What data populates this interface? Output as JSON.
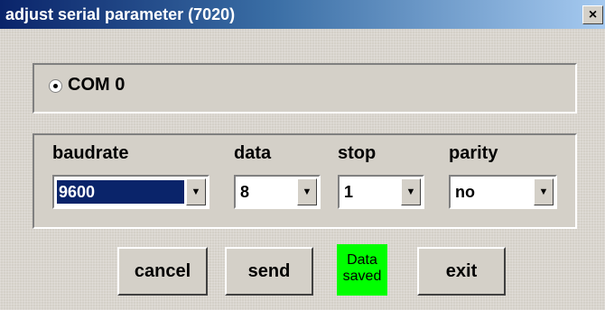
{
  "window": {
    "title": "adjust serial parameter (7020)",
    "close_glyph": "×",
    "close_icon": "close-icon"
  },
  "com": {
    "selected": true,
    "label": "COM 0"
  },
  "params": {
    "baudrate": {
      "label": "baudrate",
      "value": "9600"
    },
    "data": {
      "label": "data",
      "value": "8"
    },
    "stop": {
      "label": "stop",
      "value": "1"
    },
    "parity": {
      "label": "parity",
      "value": "no"
    },
    "dropdown_glyph": "▼",
    "dropdown_icon": "chevron-down-icon"
  },
  "buttons": {
    "cancel": "cancel",
    "send": "send",
    "exit": "exit"
  },
  "status": {
    "line1": "Data",
    "line2": "saved",
    "color": "#00ff00"
  },
  "colors": {
    "title_bar_start": "#0a246a",
    "title_bar_end": "#a6caf0",
    "face": "#d4d0c8",
    "selection": "#0a246a"
  }
}
